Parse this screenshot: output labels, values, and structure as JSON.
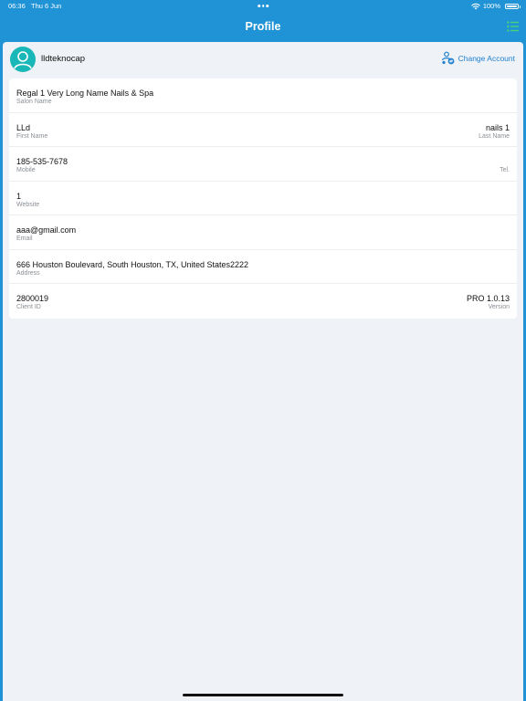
{
  "status_bar": {
    "time": "06:36",
    "date": "Thu 6 Jun",
    "battery": "100%"
  },
  "nav": {
    "title": "Profile",
    "menu_icon": "list-icon"
  },
  "account": {
    "username": "lldteknocap",
    "change_account_label": "Change Account"
  },
  "profile": {
    "salon_name": {
      "value": "Regal 1 Very Long Name Nails & Spa",
      "label": "Salon Name"
    },
    "first_name": {
      "value": "LLd",
      "label": "First Name"
    },
    "last_name": {
      "value": "nails 1",
      "label": "Last Name"
    },
    "mobile": {
      "value": "185-535-7678",
      "label": "Mobile"
    },
    "tel": {
      "value": "",
      "label": "Tel."
    },
    "website": {
      "value": "1",
      "label": "Website"
    },
    "email": {
      "value": "aaa@gmail.com",
      "label": "Email"
    },
    "address": {
      "value": "666 Houston Boulevard, South Houston, TX, United States2222",
      "label": "Address"
    },
    "client_id": {
      "value": "2800019",
      "label": "Client ID"
    },
    "version": {
      "value": "PRO 1.0.13",
      "label": "Version"
    }
  },
  "colors": {
    "header": "#1f93d6",
    "background": "#eff2f6",
    "accent": "#1e7fd0",
    "avatar": "#19b7b8",
    "menu_icon": "#45d27a"
  }
}
